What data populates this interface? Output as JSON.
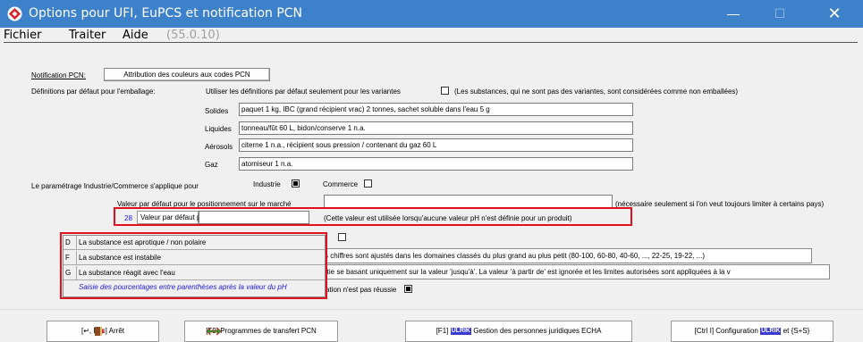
{
  "window": {
    "title": "Options pour UFI, EuPCS et notification PCN",
    "minimize": "—",
    "maximize": "☐",
    "close": "✕"
  },
  "menu": {
    "file": "Fichier",
    "process": "Traiter",
    "help": "Aide",
    "version": "(55.0.10)"
  },
  "notification": {
    "label": "Notification PCN:",
    "button": "Attribution des couleurs aux codes PCN"
  },
  "packaging": {
    "label": "Définitions par défaut pour l'emballage:",
    "variants_text": "Utiliser les définitions par défaut seulement pour les variantes",
    "variants_note": "(Les substances, qui ne sont pas des variantes, sont considérées comme non emballées)",
    "solids_label": "Solides",
    "solids_value": "paquet 1 kg, IBC (grand récipient vrac) 2 tonnes, sachet soluble dans l'eau 5 g",
    "liquids_label": "Liquides",
    "liquids_value": "tonneau/fût 60 L, bidon/conserve 1 n.a.",
    "aerosols_label": "Aérosols",
    "aerosols_value": "citerne 1 n.a., récipient sous pression / contenant du gaz 60 L",
    "gas_label": "Gaz",
    "gas_value": "atomiseur 1 n.a."
  },
  "industry": {
    "label": "Le paramétrage Industrie/Commerce s'applique pour",
    "industry": "Industrie",
    "commerce": "Commerce"
  },
  "market": {
    "label": "Valeur par défaut pour le positionnement sur le marché",
    "note": "(nécessaire seulement si l'on veut toujours limiter à certains pays)"
  },
  "ph": {
    "number": "28",
    "label": "Valeur par défaut pH",
    "note": "(Cette valeur est utilisée lorsqu'aucune valeur pH n'est définie pour un produit)"
  },
  "dropdown": {
    "items": [
      {
        "key": "D",
        "text": "La substance est aprotique / non polaire"
      },
      {
        "key": "F",
        "text": "La substance est instabile"
      },
      {
        "key": "G",
        "text": "La substance réagit avec l'eau"
      }
    ],
    "footer": "Saisie des pourcentages entre parenthèses après la valeur du pH"
  },
  "behind": {
    "line1": "s chiffres sont ajustés dans les domaines classés du plus grand au plus petit (80-100, 60-80, 40-60, ..., 22-25, 19-22, ...)",
    "line2": "rtie se basant uniquement sur la valeur 'jusqu'à'. La valeur 'à partir de' est ignorée et les limites autorisées sont appliquées à la v",
    "line3": "cation n'est pas réussie"
  },
  "buttons": {
    "stop": "[↵, Esc]  Arrêt",
    "transfer": "[F9]  Programmes de transfert PCN",
    "echa_prefix": "[F1]",
    "echa_logo": "ULRIK",
    "echa_text": "Gestion des personnes juridiques ECHA",
    "config_prefix": "[Ctrl I] Configuration",
    "config_logo": "ULRIK",
    "config_text": "et {S+S}"
  },
  "colors": {
    "titlebar": "#3c81c9",
    "highlight": "#e0101e",
    "link_blue": "#1a1ae0"
  }
}
